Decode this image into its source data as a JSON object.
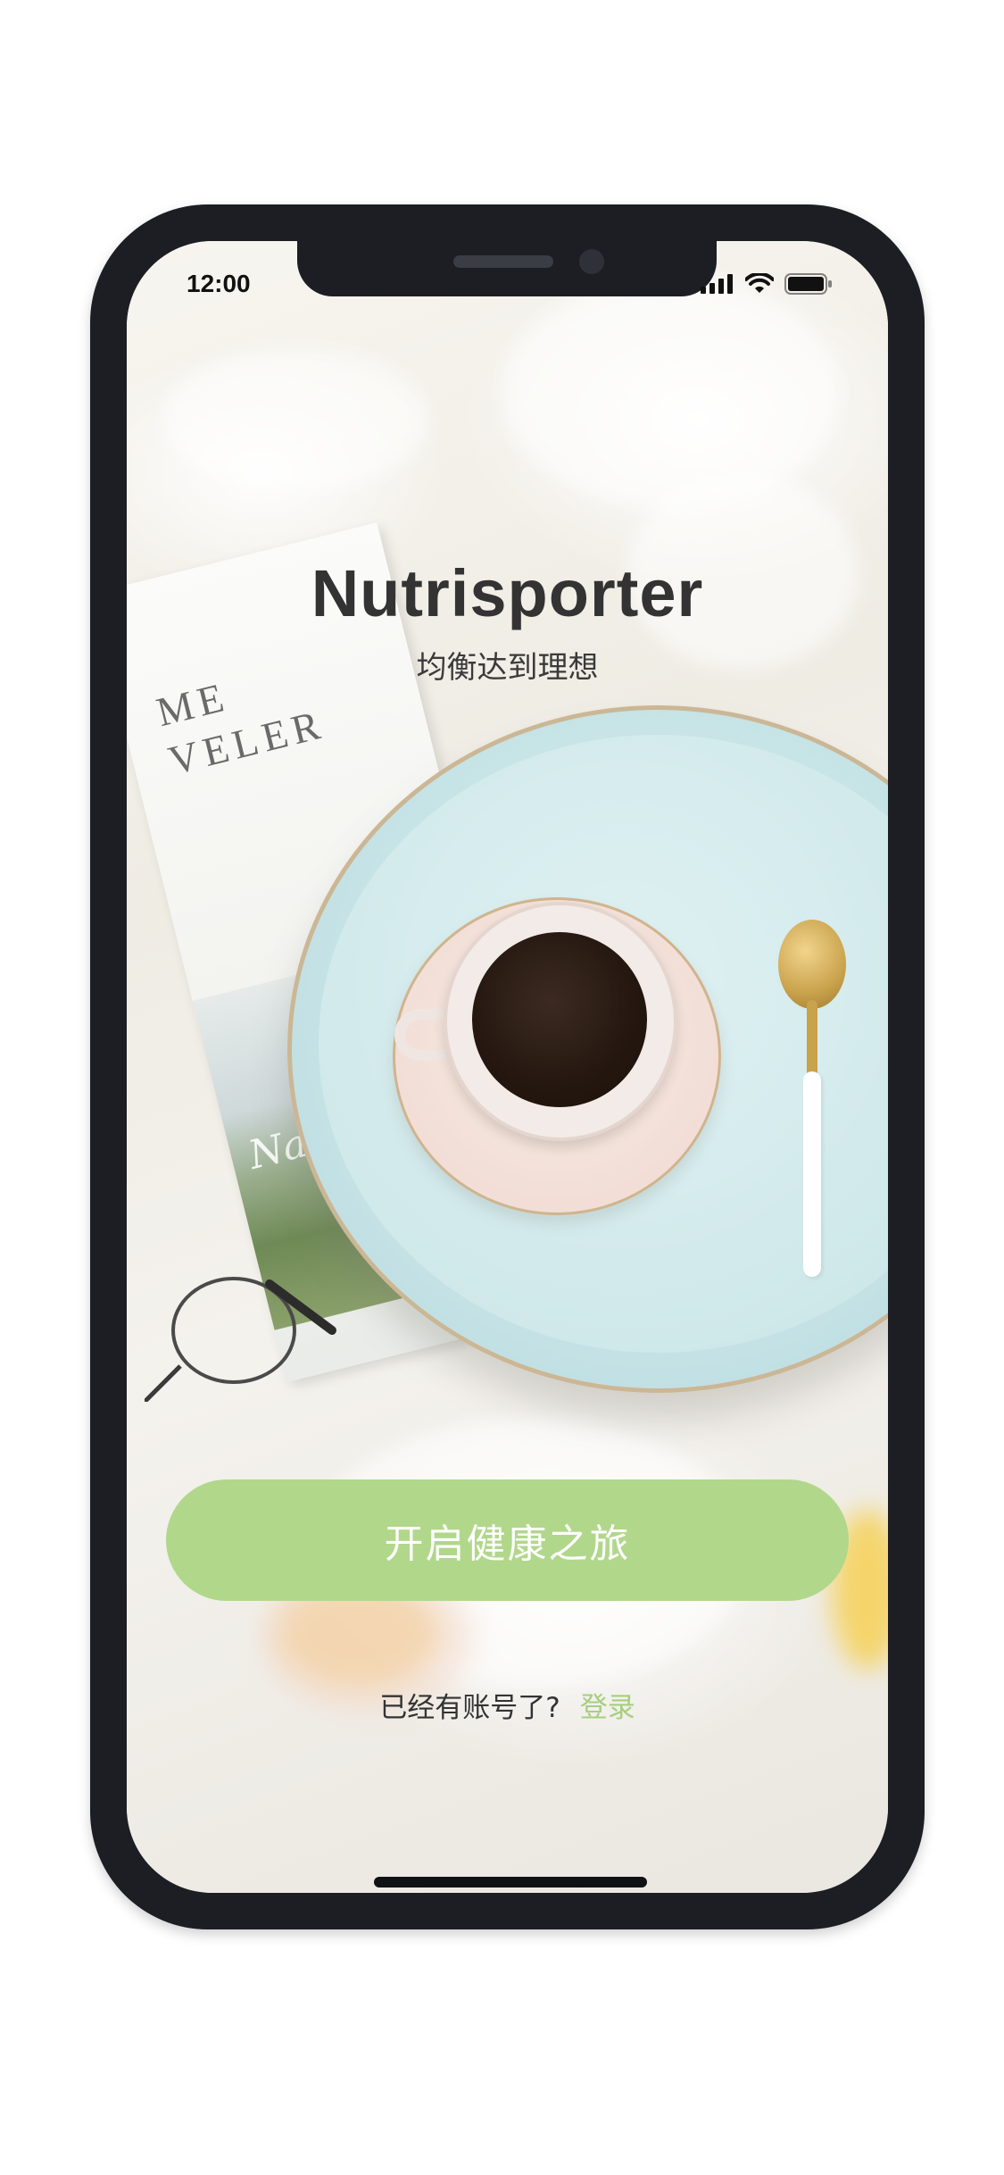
{
  "status_bar": {
    "time": "12:00"
  },
  "app": {
    "title": "Nutrisporter",
    "tagline": "均衡达到理想"
  },
  "primary_button": {
    "label": "开启健康之旅"
  },
  "login": {
    "prompt": "已经有账号了?",
    "link_label": "登录"
  },
  "background": {
    "magazine_title_line1": "ME",
    "magazine_title_line2": "VELER",
    "magazine_script": "Napak"
  },
  "colors": {
    "accent": "#b1d78b",
    "link": "#a5cf80",
    "title": "#333333",
    "frame": "#1c1e24"
  },
  "icons": {
    "signal": "cellular-signal-icon",
    "wifi": "wifi-icon",
    "battery": "battery-icon"
  }
}
